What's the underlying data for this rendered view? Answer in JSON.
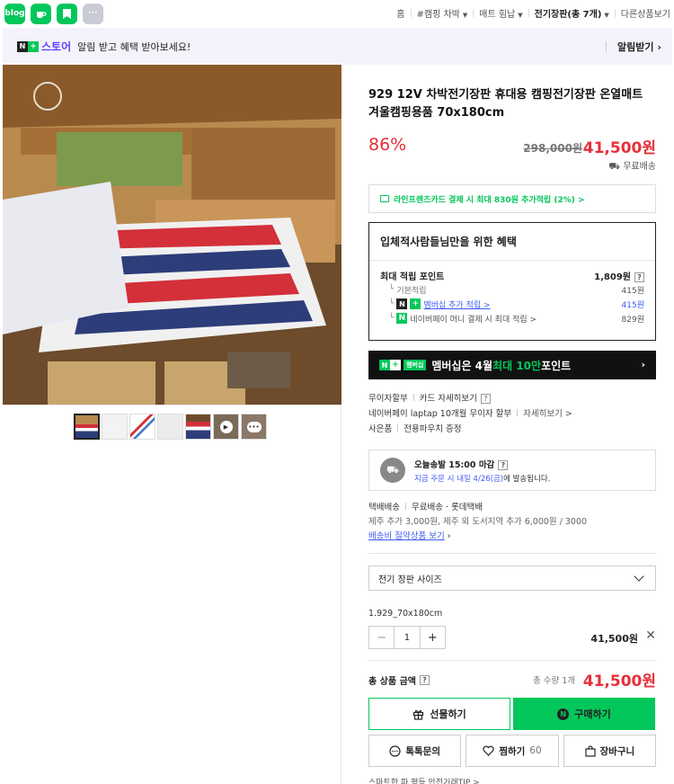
{
  "topbar": {
    "apps": [
      {
        "name": "blog",
        "label": "blog"
      },
      {
        "name": "cafe",
        "label": ""
      },
      {
        "name": "bookmark",
        "label": ""
      },
      {
        "name": "more",
        "label": "···"
      }
    ],
    "breadcrumb": {
      "home": "홈",
      "item1": "#캠핑 차박",
      "item2": "매트 힘납",
      "item3": "전기장판(총 7개)",
      "item4": "다른상품보기"
    }
  },
  "notice": {
    "logo_n": "N",
    "logo_plus": "+",
    "logo_store": "스토어",
    "text": "알림 받고 혜택 받아보세요!",
    "button": "알림받기"
  },
  "product": {
    "title": "929 12V 차박전기장판 휴대용 캠핑전기장판 온열매트 겨울캠핑용품 70x180cm",
    "discount": "86%",
    "original_price": "298,000원",
    "sale_price": "41,500원",
    "shipping_free": "무료배송"
  },
  "card_banner": "라인프렌즈카드 결제 시 최대 830원 추가적립 (2%) >",
  "benefit": {
    "title": "입체적사람들님만을 위한 혜택",
    "max_label": "최대 적립 포인트",
    "max_value": "1,809원",
    "basic_label": "기본적립",
    "basic_value": "415원",
    "member_label": "멤버십 추가 적립 >",
    "member_value": "415원",
    "money_label": "네이버페이 머니 결제 시 최대 적립 >",
    "money_value": "829원"
  },
  "membership": {
    "badge": "멤버십",
    "text_a": "멤버십은 4월 ",
    "text_b": "최대 10만",
    "text_c": " 포인트"
  },
  "info": {
    "row1_a": "무이자할부",
    "row1_b": "카드 자세히보기",
    "row2_a": "네이버페이 laptap 10개월 무이자 할부",
    "row2_b": "자세히보기 >",
    "row3_a": "사은품",
    "row3_b": "전용파우치 증정"
  },
  "ship_box": {
    "title": "오늘송발 15:00 마감",
    "sub_blue": "지금 주문 시 내일 4/26(금)",
    "sub_black": "에 발송됩니다."
  },
  "delivery": {
    "line1_a": "택배배송",
    "line1_b": "무료배송 · 롯데택배",
    "line2": "제주 추가 3,000원, 제주 외 도서지역 추가 6,000원 / 3000",
    "line3": "배송비 절약상품 보기"
  },
  "option": {
    "select_label": "전기 장판 사이즈",
    "selected_name": "1.929_70x180cm",
    "qty": "1",
    "price": "41,500원"
  },
  "total": {
    "label": "총 상품 금액",
    "count": "총 수량 1개",
    "price": "41,500원"
  },
  "buttons": {
    "gift": "선물하기",
    "buy": "구매하기",
    "talk": "톡톡문의",
    "wish": "찜하기",
    "wish_count": "60",
    "cart": "장바구니"
  },
  "footnote": "스마트한 파 평등 안전거래TIP >"
}
